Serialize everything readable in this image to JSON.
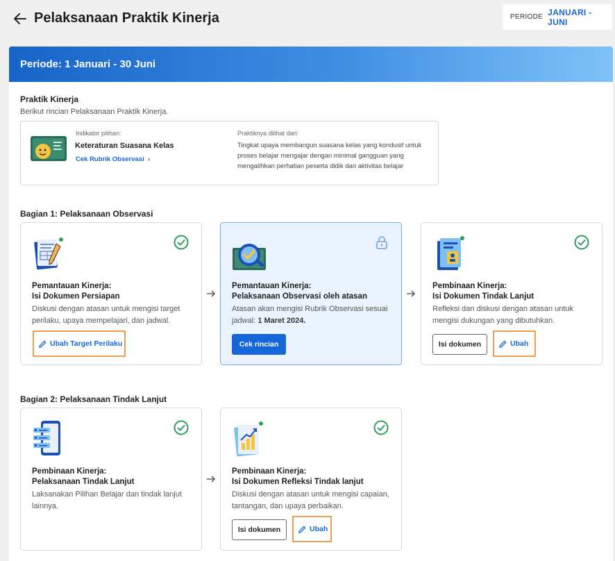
{
  "header": {
    "title": "Pelaksanaan Praktik Kinerja",
    "period_label": "PERIODE",
    "period_value": "JANUARI - JUNI"
  },
  "banner": {
    "title": "Periode: 1 Januari - 30 Juni"
  },
  "praktik": {
    "title": "Praktik Kinerja",
    "subtitle": "Berikut rincian Pelaksanaan Praktik Kinerja.",
    "indicator_label": "Indikator pilihan:",
    "indicator_name": "Keteraturan Suasana Kelas",
    "rubrik_link": "Cek Rubrik Observasi",
    "seen_label": "Praktiknya dilihat dari:",
    "seen_desc": "Tingkat upaya membangun suasana kelas yang kondusif untuk proses belajar mengajar dengan minimal gangguan yang mengalihkan perhatian peserta didik dari aktivitas belajar"
  },
  "bagian1": {
    "title": "Bagian 1: Pelaksanaan Observasi",
    "cards": [
      {
        "title_line1": "Pemantauan Kinerja:",
        "title_line2": "Isi Dokumen Persiapan",
        "desc": "Diskusi dengan atasan untuk mengisi target perilaku, upaya mempelajari, dan jadwal.",
        "action": "Ubah Target Perilaku",
        "status": "check-circle-icon"
      },
      {
        "title_line1": "Pemantauan Kinerja:",
        "title_line2": "Pelaksanaan Observasi oleh atasan",
        "desc_prefix": "Atasan akan mengisi Rubrik Observasi sesuai jadwal:",
        "desc_date": "1 Maret 2024.",
        "action": "Cek rincian",
        "status": "lock-icon"
      },
      {
        "title_line1": "Pembinaan Kinerja:",
        "title_line2": "Isi Dokumen Tindak Lanjut",
        "desc": "Refleksi dan diskusi dengan atasan untuk mengisi dukungan yang dibutuhkan.",
        "action_secondary": "Isi dokumen",
        "action": "Ubah",
        "status": "check-circle-icon"
      }
    ]
  },
  "bagian2": {
    "title": "Bagian 2: Pelaksanaan Tindak Lanjut",
    "cards": [
      {
        "title_line1": "Pembinaan Kinerja:",
        "title_line2": "Pelaksanaan Tindak Lanjut",
        "desc": "Laksanakan Pilihan Belajar dan tindak lanjut lainnya.",
        "status": "check-circle-icon"
      },
      {
        "title_line1": "Pembinaan Kinerja:",
        "title_line2": "Isi Dokumen Refleksi Tindak lanjut",
        "desc": "Diskusi dengan atasan untuk mengisi capaian, tantangan, dan upaya perbaikan.",
        "action_secondary": "Isi dokumen",
        "action": "Ubah",
        "status": "check-circle-icon"
      }
    ]
  },
  "colors": {
    "accent": "#1566d9",
    "success": "#2f9e5b",
    "highlight_border": "#ef9b50"
  }
}
